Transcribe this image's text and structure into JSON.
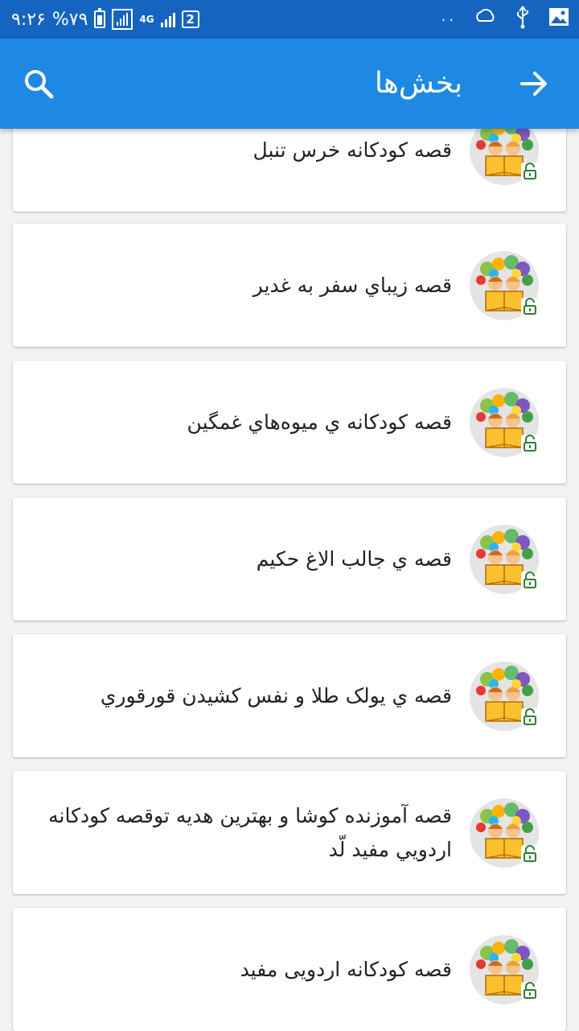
{
  "status_bar": {
    "time": "۹:۲۶",
    "battery": "%۷۹",
    "network": "4G",
    "sim": "2",
    "dots": "۰۰"
  },
  "app_bar": {
    "title": "بخش‌ها",
    "back_icon": "arrow-forward-icon",
    "search_icon": "search-icon"
  },
  "stories": [
    {
      "title": "قصه کودکانه خرس تنبل"
    },
    {
      "title": "قصه زيباي سفر به غدير"
    },
    {
      "title": "قصه کودکانه ي ميوه‌هاي غمگين"
    },
    {
      "title": "قصه ي جالب الاغ حکيم"
    },
    {
      "title": "قصه ي يولک طلا و نفس کشيدن قورقوري"
    },
    {
      "title": "قصه آموزنده کوشا و بهترين هديه توقصه کودکانه اردويي مفيد لّد"
    },
    {
      "title": "قصه کودکانه اردویی مفید"
    }
  ],
  "colors": {
    "status_bar": "#1565c0",
    "app_bar": "#1e88e5",
    "lock": "#2e7d32"
  }
}
